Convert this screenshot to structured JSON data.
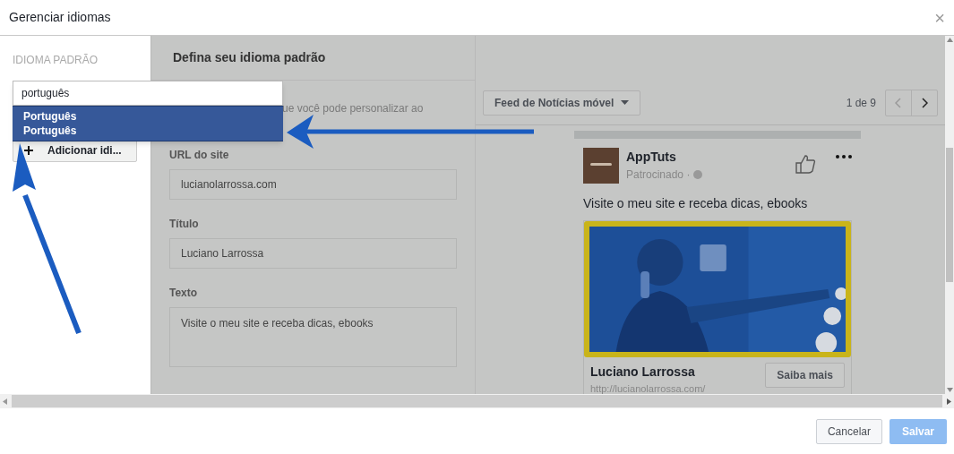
{
  "dialog": {
    "title": "Gerenciar idiomas",
    "close": "×"
  },
  "sidebar": {
    "heading": "IDIOMA PADRÃO",
    "search": {
      "value": "português"
    },
    "suggestions": [
      {
        "label": "Português",
        "sublabel": "Português",
        "selected": true
      }
    ],
    "add_button": {
      "label": "Adicionar idi..."
    }
  },
  "form": {
    "heading": "Defina seu idioma padrão",
    "hint": "ue você pode personalizar ao",
    "fields": [
      {
        "label": "URL do site",
        "value": "lucianolarrossa.com",
        "kind": "input"
      },
      {
        "label": "Título",
        "value": "Luciano Larrossa",
        "kind": "input"
      },
      {
        "label": "Texto",
        "value": "Visite o meu site e receba dicas, ebooks",
        "kind": "textarea"
      }
    ]
  },
  "preview": {
    "placement": "Feed de Notícias móvel",
    "pager": "1 de 9",
    "post": {
      "page": "AppTuts",
      "sponsored": "Patrocinado ·",
      "text": "Visite o meu site e receba dicas, ebooks",
      "headline": "Luciano Larrossa",
      "link": "http://lucianolarrossa.com/",
      "cta": "Saiba mais"
    }
  },
  "buttons": [
    {
      "label": "Cancelar",
      "kind": "secondary",
      "disabled": false
    },
    {
      "label": "Salvar",
      "kind": "primary",
      "disabled": true
    }
  ]
}
